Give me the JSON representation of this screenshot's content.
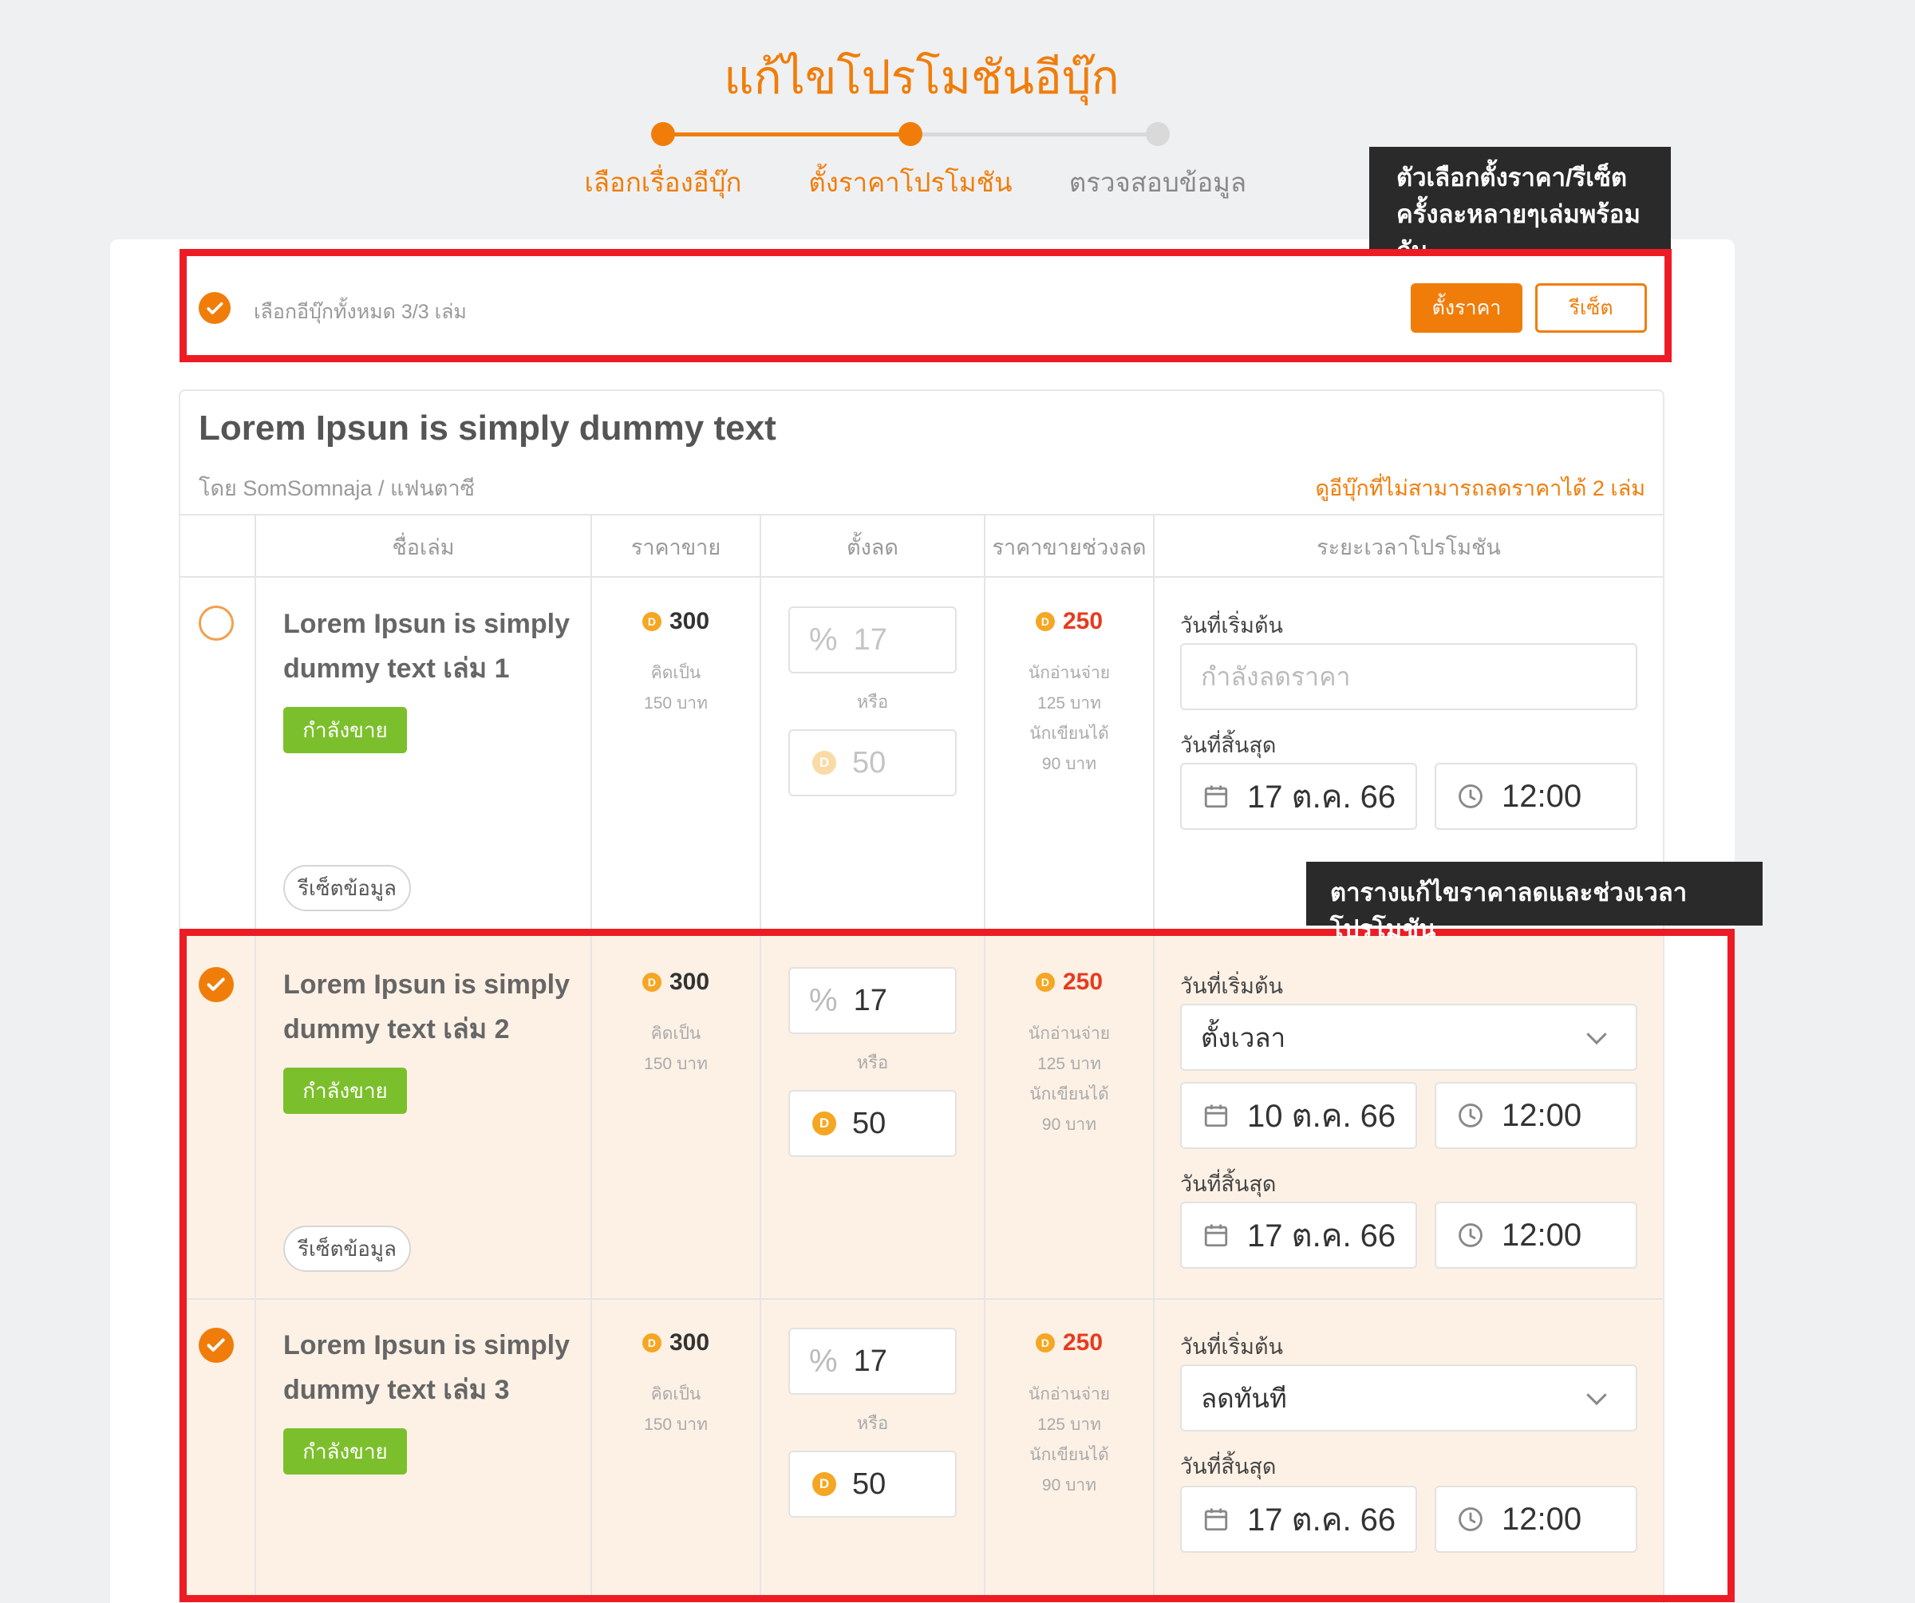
{
  "page": {
    "title": "แก้ไขโปรโมชันอีบุ๊ก",
    "steps": [
      "เลือกเรื่องอีบุ๊ก",
      "ตั้งราคาโปรโมชัน",
      "ตรวจสอบข้อมูล"
    ]
  },
  "colors": {
    "accent": "#f07d0a",
    "highlight": "#ed1c24",
    "sale_badge": "#7cbf2c",
    "row_selected": "#fdf1e6"
  },
  "bulk": {
    "select_all_text": "เลือกอีบุ๊กทั้งหมด 3/3 เล่ม",
    "set_price_label": "ตั้งราคา",
    "reset_label": "รีเซ็ต"
  },
  "annotations": {
    "bulk_note_line1": "ตัวเลือกตั้งราคา/รีเซ็ต",
    "bulk_note_line2": "ครั้งละหลายๆเล่มพร้อมกัน",
    "table_note": "ตารางแก้ไขราคาลดและช่วงเวลาโปรโมชัน"
  },
  "book": {
    "title": "Lorem Ipsun is simply dummy text",
    "byline": "โดย SomSomnaja / แฟนตาซี",
    "link": "ดูอีบุ๊กที่ไม่สามารถลดราคาได้ 2 เล่ม"
  },
  "columns": [
    "ชื่อเล่ม",
    "ราคาขาย",
    "ตั้งลด",
    "ราคาขายช่วงลด",
    "ระยะเวลาโปรโมชัน"
  ],
  "labels": {
    "coin_symbol": "D",
    "equiv": "คิดเป็น",
    "or": "หรือ",
    "reader_pays": "นักอ่านจ่าย",
    "writer_gets": "นักเขียนได้",
    "start_date": "วันที่เริ่มต้น",
    "end_date": "วันที่สิ้นสุด",
    "pct": "%",
    "reset_data": "รีเซ็ตข้อมูล",
    "on_sale": "กำลังขาย"
  },
  "rows": [
    {
      "line1": "Lorem Ipsun is simply",
      "line2": "dummy text เล่ม 1",
      "selected": false,
      "price": "300",
      "price_baht": "150 บาท",
      "discount_pct": "17",
      "discount_coin": "50",
      "sale_price": "250",
      "reader_baht": "125 บาท",
      "writer_baht": "90 บาท",
      "start_field": "กำลังลดราคา",
      "end_date": "17 ต.ค. 66",
      "end_time": "12:00"
    },
    {
      "line1": "Lorem Ipsun is simply",
      "line2": "dummy text เล่ม 2",
      "selected": true,
      "price": "300",
      "price_baht": "150 บาท",
      "discount_pct": "17",
      "discount_coin": "50",
      "sale_price": "250",
      "reader_baht": "125 บาท",
      "writer_baht": "90 บาท",
      "start_select": "ตั้งเวลา",
      "start_date": "10 ต.ค. 66",
      "start_time": "12:00",
      "end_date": "17 ต.ค. 66",
      "end_time": "12:00"
    },
    {
      "line1": "Lorem Ipsun is simply",
      "line2": "dummy text เล่ม 3",
      "selected": true,
      "price": "300",
      "price_baht": "150 บาท",
      "discount_pct": "17",
      "discount_coin": "50",
      "sale_price": "250",
      "reader_baht": "125 บาท",
      "writer_baht": "90 บาท",
      "start_select": "ลดทันที",
      "end_date": "17 ต.ค. 66",
      "end_time": "12:00"
    }
  ]
}
